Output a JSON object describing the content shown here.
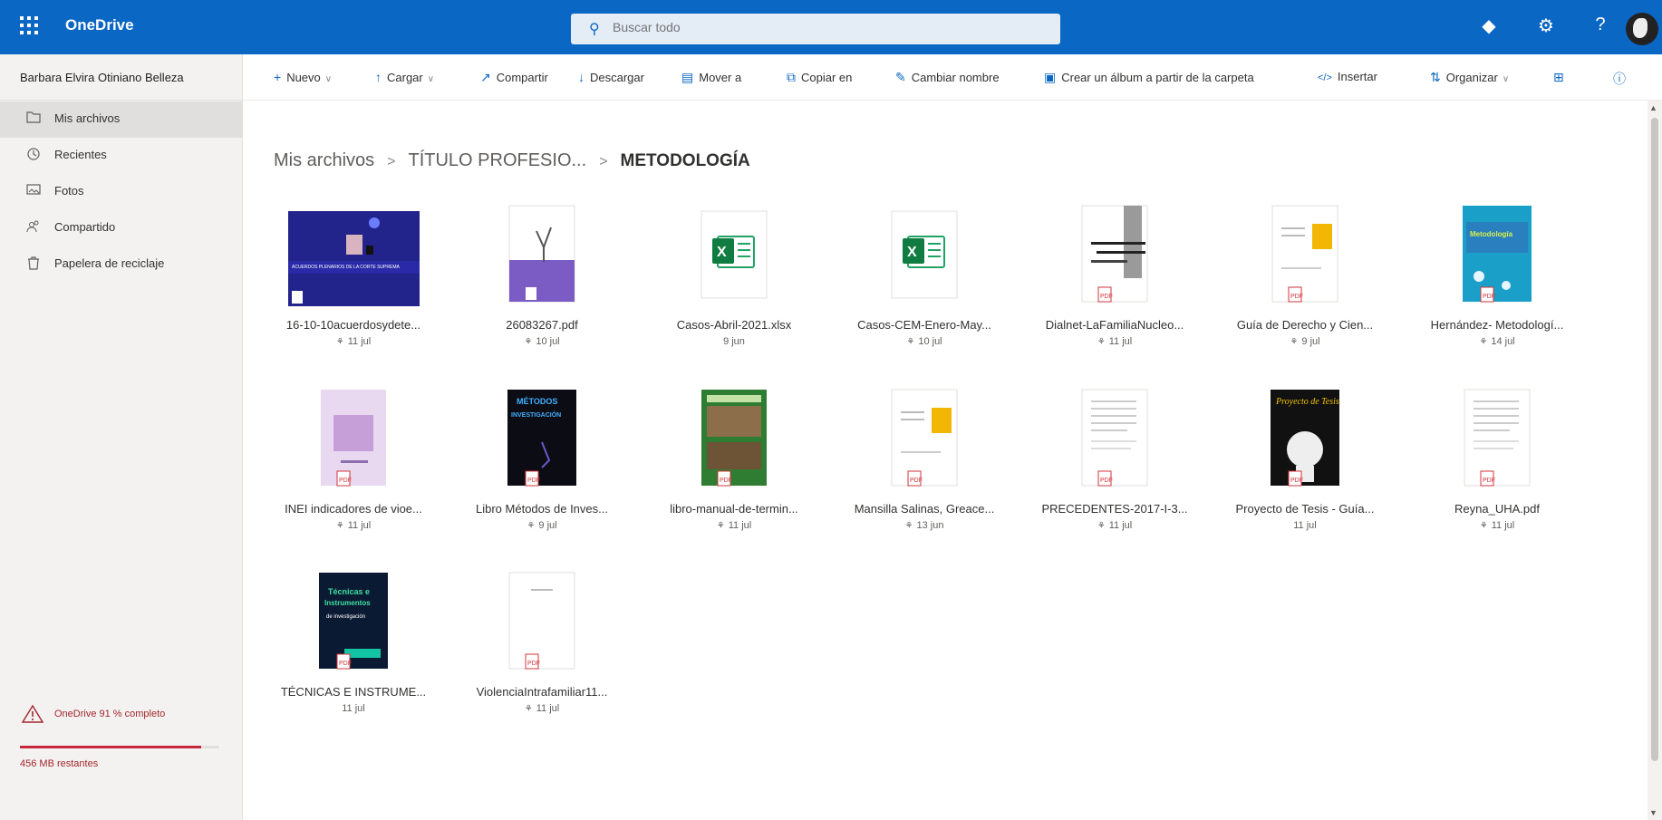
{
  "app": {
    "name": "OneDrive",
    "search_placeholder": "Buscar todo",
    "brand_color": "#0a67c4"
  },
  "topbar_icons": [
    "diamond-icon",
    "gear-icon",
    "help-icon"
  ],
  "sidebar": {
    "user": "Barbara Elvira Otiniano Belleza",
    "items": [
      {
        "label": "Mis archivos",
        "icon": "folder-icon",
        "active": true
      },
      {
        "label": "Recientes",
        "icon": "clock-icon",
        "active": false
      },
      {
        "label": "Fotos",
        "icon": "photo-icon",
        "active": false
      },
      {
        "label": "Compartido",
        "icon": "people-icon",
        "active": false
      },
      {
        "label": "Papelera de reciclaje",
        "icon": "trash-icon",
        "active": false
      }
    ],
    "quota_text": "OneDrive 91 % completo",
    "quota_used": 0.91,
    "quota_remaining": "456 MB restantes"
  },
  "commands": {
    "nuevo": "Nuevo",
    "cargar": "Cargar",
    "compartir": "Compartir",
    "descargar": "Descargar",
    "mover": "Mover a",
    "copiar": "Copiar en",
    "cambiar": "Cambiar nombre",
    "album": "Crear un álbum a partir de la carpeta",
    "insertar": "Insertar",
    "organizar": "Organizar"
  },
  "breadcrumb": {
    "root": "Mis archivos",
    "parent": "TÍTULO PROFESIO...",
    "current": "METODOLOGÍA"
  },
  "files": [
    {
      "name": "16-10-10acuerdosydete...",
      "date": "11 jul",
      "shared": true,
      "kind": "pdf-blue"
    },
    {
      "name": "26083267.pdf",
      "date": "10 jul",
      "shared": true,
      "kind": "pdf-purple"
    },
    {
      "name": "Casos-Abril-2021.xlsx",
      "date": "9 jun",
      "shared": false,
      "kind": "excel"
    },
    {
      "name": "Casos-CEM-Enero-May...",
      "date": "10 jul",
      "shared": true,
      "kind": "excel"
    },
    {
      "name": "Dialnet-LaFamiliaNucleo...",
      "date": "11 jul",
      "shared": true,
      "kind": "pdf-gray"
    },
    {
      "name": "Guía de Derecho y Cien...",
      "date": "9 jul",
      "shared": true,
      "kind": "pdf-yellow"
    },
    {
      "name": "Hernández- Metodologí...",
      "date": "14 jul",
      "shared": true,
      "kind": "pdf-cyan"
    },
    {
      "name": "INEI indicadores de vioe...",
      "date": "11 jul",
      "shared": true,
      "kind": "pdf-lilac"
    },
    {
      "name": "Libro Métodos de Inves...",
      "date": "9 jul",
      "shared": true,
      "kind": "pdf-dark"
    },
    {
      "name": "libro-manual-de-termin...",
      "date": "11 jul",
      "shared": true,
      "kind": "pdf-green"
    },
    {
      "name": "Mansilla Salinas, Greace...",
      "date": "13 jun",
      "shared": true,
      "kind": "pdf-yellow"
    },
    {
      "name": "PRECEDENTES-2017-I-3...",
      "date": "11 jul",
      "shared": true,
      "kind": "pdf-doc"
    },
    {
      "name": "Proyecto de Tesis - Guía...",
      "date": "11 jul",
      "shared": false,
      "kind": "pdf-black"
    },
    {
      "name": "Reyna_UHA.pdf",
      "date": "11 jul",
      "shared": true,
      "kind": "pdf-doc"
    },
    {
      "name": "TÉCNICAS E INSTRUME...",
      "date": "11 jul",
      "shared": false,
      "kind": "pdf-navy"
    },
    {
      "name": "ViolenciaIntrafamiliar11...",
      "date": "11 jul",
      "shared": true,
      "kind": "pdf-blank"
    }
  ]
}
